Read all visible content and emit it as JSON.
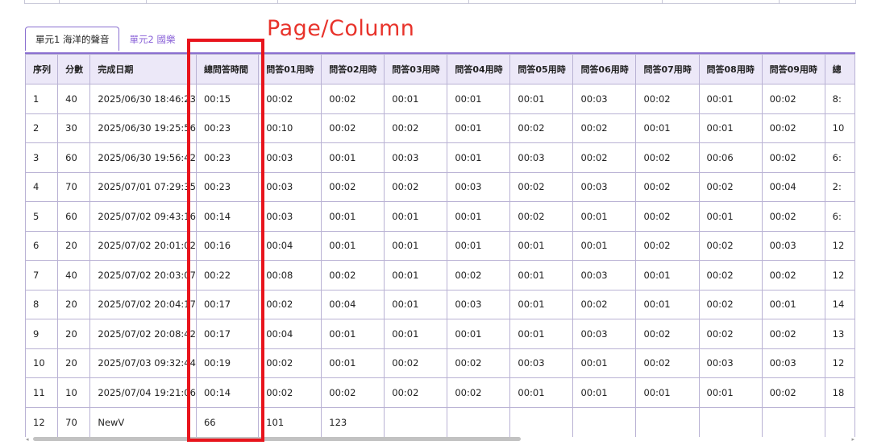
{
  "annotation": {
    "label": "Page/Column",
    "color": "#e8332b"
  },
  "tabs": [
    {
      "label": "單元1 海洋的聲音",
      "active": true
    },
    {
      "label": "單元2 國樂",
      "active": false
    }
  ],
  "table": {
    "headers": [
      "序列",
      "分數",
      "完成日期",
      "總問答時間",
      "問答01用時",
      "問答02用時",
      "問答03用時",
      "問答04用時",
      "問答05用時",
      "問答06用時",
      "問答07用時",
      "問答08用時",
      "問答09用時",
      "總"
    ],
    "rows": [
      [
        "1",
        "40",
        "2025/06/30 18:46:23",
        "00:15",
        "00:02",
        "00:02",
        "00:01",
        "00:01",
        "00:01",
        "00:03",
        "00:02",
        "00:01",
        "00:02",
        "8:"
      ],
      [
        "2",
        "30",
        "2025/06/30 19:25:56",
        "00:23",
        "00:10",
        "00:02",
        "00:02",
        "00:01",
        "00:02",
        "00:02",
        "00:01",
        "00:01",
        "00:02",
        "10"
      ],
      [
        "3",
        "60",
        "2025/06/30 19:56:42",
        "00:23",
        "00:03",
        "00:01",
        "00:03",
        "00:01",
        "00:03",
        "00:02",
        "00:02",
        "00:06",
        "00:02",
        "6:"
      ],
      [
        "4",
        "70",
        "2025/07/01 07:29:35",
        "00:23",
        "00:03",
        "00:02",
        "00:02",
        "00:03",
        "00:02",
        "00:03",
        "00:02",
        "00:02",
        "00:04",
        "2:"
      ],
      [
        "5",
        "60",
        "2025/07/02 09:43:16",
        "00:14",
        "00:03",
        "00:01",
        "00:01",
        "00:01",
        "00:02",
        "00:01",
        "00:02",
        "00:01",
        "00:02",
        "6:"
      ],
      [
        "6",
        "20",
        "2025/07/02 20:01:02",
        "00:16",
        "00:04",
        "00:01",
        "00:01",
        "00:01",
        "00:01",
        "00:01",
        "00:02",
        "00:02",
        "00:03",
        "12"
      ],
      [
        "7",
        "40",
        "2025/07/02 20:03:07",
        "00:22",
        "00:08",
        "00:02",
        "00:01",
        "00:02",
        "00:01",
        "00:03",
        "00:01",
        "00:02",
        "00:02",
        "12"
      ],
      [
        "8",
        "20",
        "2025/07/02 20:04:17",
        "00:17",
        "00:02",
        "00:04",
        "00:01",
        "00:03",
        "00:01",
        "00:02",
        "00:01",
        "00:02",
        "00:01",
        "14"
      ],
      [
        "9",
        "20",
        "2025/07/02 20:08:42",
        "00:17",
        "00:04",
        "00:01",
        "00:01",
        "00:01",
        "00:01",
        "00:03",
        "00:02",
        "00:02",
        "00:02",
        "13"
      ],
      [
        "10",
        "20",
        "2025/07/03 09:32:44",
        "00:19",
        "00:02",
        "00:01",
        "00:02",
        "00:02",
        "00:03",
        "00:01",
        "00:02",
        "00:03",
        "00:03",
        "12"
      ],
      [
        "11",
        "10",
        "2025/07/04 19:21:06",
        "00:14",
        "00:02",
        "00:02",
        "00:02",
        "00:02",
        "00:01",
        "00:01",
        "00:01",
        "00:01",
        "00:02",
        "18"
      ],
      [
        "12",
        "70",
        "NewV",
        "66",
        "101",
        "123",
        "",
        "",
        "",
        "",
        "",
        "",
        "",
        ""
      ]
    ]
  },
  "colors": {
    "accent": "#8a6fd0",
    "header_bg": "#ece8f8",
    "highlight": "#e8141c",
    "tab_inactive": "#8a62d8"
  },
  "scrollbar": {
    "left_arrow": "◂",
    "right_arrow": "▸"
  }
}
